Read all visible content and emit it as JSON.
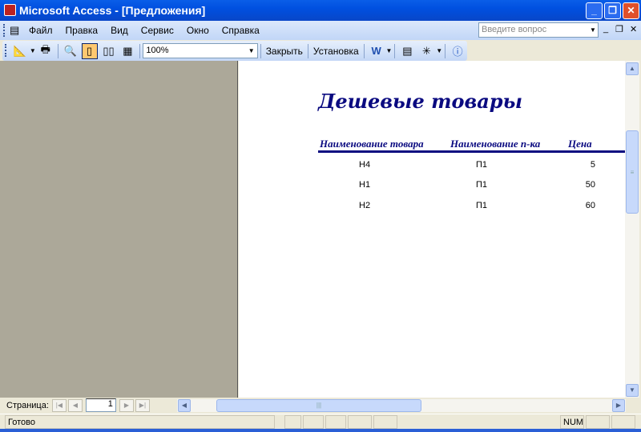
{
  "window": {
    "title": "Microsoft Access - [Предложения]"
  },
  "menu": {
    "items": [
      "Файл",
      "Правка",
      "Вид",
      "Сервис",
      "Окно",
      "Справка"
    ],
    "ask_placeholder": "Введите вопрос"
  },
  "toolbar": {
    "zoom_value": "100%",
    "close_label": "Закрыть",
    "setup_label": "Установка"
  },
  "report": {
    "title": "Дешевые товары",
    "columns": [
      "Наименование товара",
      "Наименование п-ка",
      "Цена"
    ],
    "rows": [
      [
        "Н4",
        "П1",
        "5"
      ],
      [
        "Н1",
        "П1",
        "50"
      ],
      [
        "Н2",
        "П1",
        "60"
      ]
    ]
  },
  "nav": {
    "page_label": "Страница:",
    "page_value": "1"
  },
  "status": {
    "text": "Готово",
    "num": "NUM"
  },
  "colors": {
    "title_blue": "#0050e0",
    "report_navy": "#0a0a80",
    "left_panel": "#aca899"
  }
}
